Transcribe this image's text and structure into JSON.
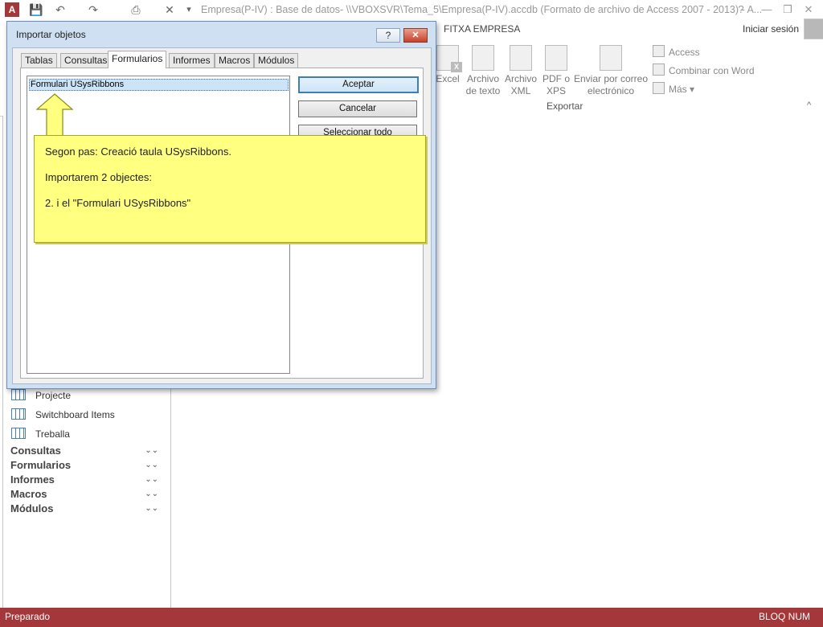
{
  "window": {
    "app_icon": "A",
    "title": "Empresa(P-IV) : Base de datos- \\\\VBOXSVR\\Tema_5\\Empresa(P-IV).accdb (Formato de archivo de Access 2007 - 2013) - A...",
    "help": "?",
    "minimize": "—",
    "restore": "❐",
    "close": "✕"
  },
  "qat": {
    "save": "💾",
    "undo": "↶",
    "redo": "↷",
    "print_preview": "⎙",
    "x": "✕",
    "customize": "▾"
  },
  "ribbon": {
    "tab_context": "FITXA EMPRESA",
    "signin": "Iniciar sesión",
    "buttons": [
      {
        "label": "Excel"
      },
      {
        "label": "Archivo de texto"
      },
      {
        "label": "Archivo XML"
      },
      {
        "label": "PDF o XPS"
      },
      {
        "label": "Enviar por correo electrónico"
      }
    ],
    "small_buttons": [
      "Access",
      "Combinar con Word",
      "Más"
    ],
    "group_label": "Exportar",
    "collapse": "^"
  },
  "nav": {
    "items": [
      "Projecte",
      "Switchboard Items",
      "Treballa"
    ],
    "groups": [
      "Consultas",
      "Formularios",
      "Informes",
      "Macros",
      "Módulos"
    ],
    "chevron": "⌄⌄"
  },
  "status": {
    "left": "Preparado",
    "right": "BLOQ NUM"
  },
  "dialog": {
    "title": "Importar objetos",
    "help": "?",
    "close": "✕",
    "tabs": [
      "Tablas",
      "Consultas",
      "Formularios",
      "Informes",
      "Macros",
      "Módulos"
    ],
    "active_tab": "Formularios",
    "list_items": [
      "Formulari USysRibbons"
    ],
    "buttons": {
      "ok": "Aceptar",
      "cancel": "Cancelar",
      "select_all": "Seleccionar todo"
    }
  },
  "callout": {
    "line1": "Segon pas: Creació taula USysRibbons.",
    "line2": "Importarem 2 objectes:",
    "line3": "2.  i el \"Formulari USysRibbons\""
  },
  "colors": {
    "status_bar": "#a4373a",
    "callout": "#ffff80",
    "dialog_frame": "#cfe0f2"
  }
}
